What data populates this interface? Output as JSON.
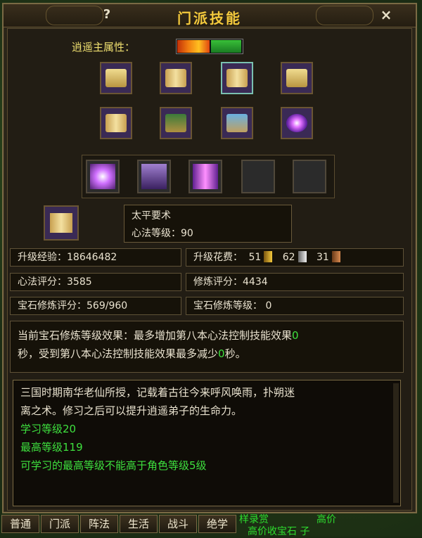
{
  "window": {
    "title": "门派技能",
    "help_label": "?",
    "close_label": "×"
  },
  "attribute": {
    "label": "逍遥主属性："
  },
  "skill_icons": [
    "book-icon",
    "scroll-icon",
    "scroll-icon",
    "book-icon",
    "scroll-icon",
    "chest-icon",
    "blue-scroll-icon",
    "galaxy-icon"
  ],
  "selected_skill": {
    "name": "太平要术",
    "level_text": "心法等级：90"
  },
  "stats": {
    "exp": "升级经验：18646482",
    "cost_label": "升级花费：",
    "cost_gold": "51",
    "cost_silver": "62",
    "cost_bronze": "31",
    "xinfa_score": "心法评分：3585",
    "xiulian_score": "修炼评分：4434",
    "gem_score": "宝石修炼评分：569/960",
    "gem_level": "宝石修炼等级：  0"
  },
  "effect": {
    "line1": "当前宝石修炼等级效果：最多增加第八本心法控制技能效果",
    "val1": "0",
    "line2a": "秒，受到第八本心法控制技能效果最多减少",
    "val2": "0",
    "line2b": "秒。"
  },
  "description": {
    "line1": "三国时期南华老仙所授，记载着古往今来呼风唤雨，扑朔迷",
    "line2": "离之术。修习之后可以提升逍遥弟子的生命力。",
    "learn_level": "学习等级20",
    "max_level": "最高等级119",
    "limit": "可学习的最高等级不能高于角色等级5级"
  },
  "tabs": [
    "普通",
    "门派",
    "阵法",
    "生活",
    "战斗",
    "绝学"
  ],
  "chat": {
    "t1": "样录赏",
    "t2": "高价",
    "t3": "高价收宝石 子"
  }
}
